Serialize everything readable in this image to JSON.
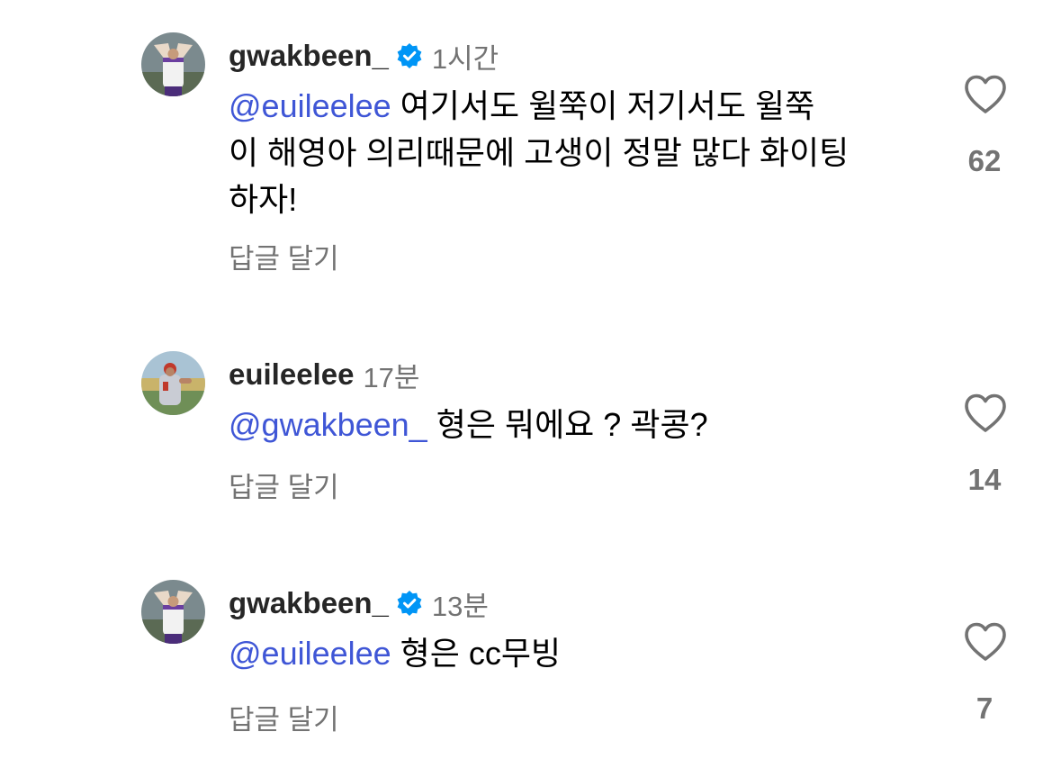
{
  "comments": [
    {
      "username": "gwakbeen_",
      "verified": true,
      "time": "1시간",
      "mention": "@euileelee",
      "line1": " 여기서도 윌쭉이 저기서도 윌쭉",
      "line2": "이 해영아 의리때문에 고생이 정말 많다 화이팅",
      "line3": "하자!",
      "reply_label": "답글 달기",
      "likes": "62"
    },
    {
      "username": "euileelee",
      "verified": false,
      "time": "17분",
      "mention": "@gwakbeen_",
      "line1": " 형은 뭐에요 ? 곽콩?",
      "reply_label": "답글 달기",
      "likes": "14"
    },
    {
      "username": "gwakbeen_",
      "verified": true,
      "time": "13분",
      "mention": "@euileelee",
      "line1": " 형은 cc무빙",
      "reply_label": "답글 달기",
      "likes": "7"
    }
  ],
  "icons": {
    "like": "heart-outline-icon",
    "verified": "verified-badge-icon"
  },
  "colors": {
    "mention": "#3f56d6",
    "verified": "#0095f6",
    "secondary_text": "#737373",
    "username": "#262626"
  }
}
